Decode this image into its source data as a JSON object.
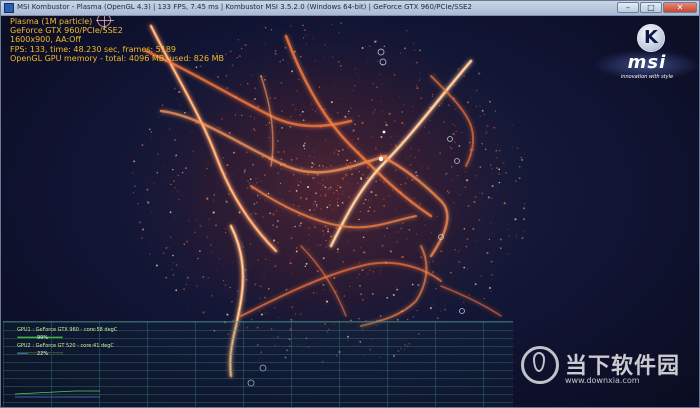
{
  "window": {
    "title": "MSI Kombustor - Plasma (OpenGL 4.3) | 133 FPS, 7.45 ms | Kombustor MSI 3.5.2.0 (Windows 64-bit) | GeForce GTX 960/PCIe/SSE2",
    "minimize_label": "–",
    "maximize_label": "□",
    "close_label": "✕"
  },
  "overlay": {
    "lines": [
      "Plasma (1M particle)",
      "GeForce GTX 960/PCIe/SSE2",
      "1600x900, AA:Off",
      "FPS: 133, time: 48.230 sec, frames: 5189",
      "OpenGL GPU memory - total: 4096 MB, used: 826 MB"
    ]
  },
  "logo": {
    "letter": "K",
    "brand": "msi",
    "tagline": "innovation with style"
  },
  "gpu_monitor": {
    "gpu1_label": "GPU1 : GeForce GTX 960 - core:58 degC",
    "gpu1_value": "99%",
    "gpu1_load": 0.99,
    "gpu1_color": "#22c43a",
    "gpu2_label": "GPU2 : GeForce GT 520 - core:41 degC",
    "gpu2_value": "22%",
    "gpu2_load": 0.22,
    "gpu2_color": "#3f5fb8"
  },
  "watermark": {
    "title": "当下软件园",
    "url": "www.downxia.com"
  },
  "colors": {
    "overlay_text": "#f2ba2a",
    "particle_core": "#ffd8a0",
    "particle_mid": "#ff7a3a",
    "particle_dim": "#c8402a",
    "background": "#111433"
  }
}
